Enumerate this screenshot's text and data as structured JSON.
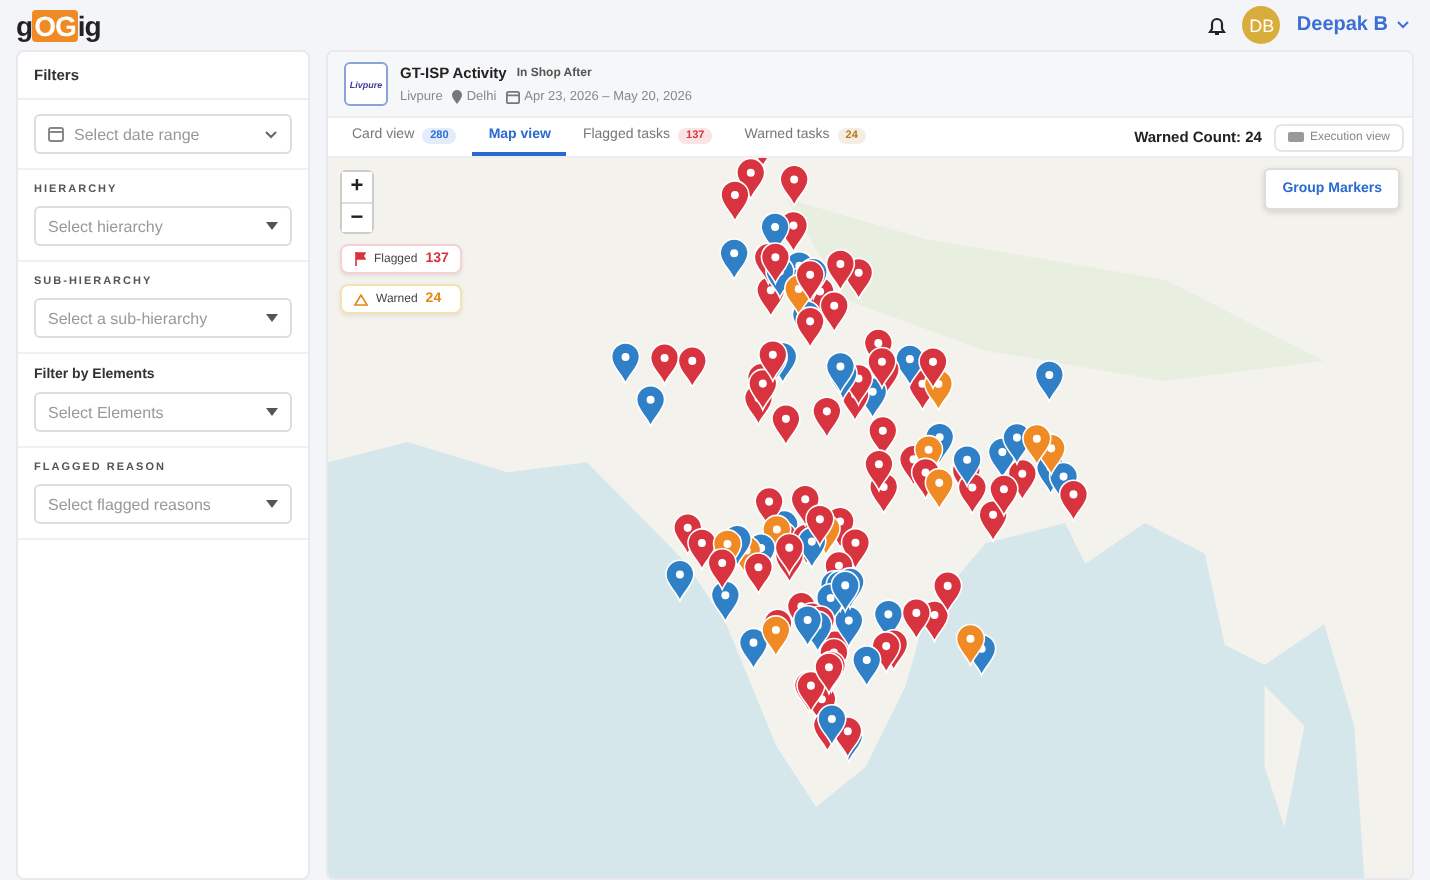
{
  "logo": {
    "before": "g",
    "highlight": "OG",
    "after": "ig"
  },
  "user": {
    "initials": "DB",
    "name": "Deepak B"
  },
  "filters": {
    "title": "Filters",
    "items": [
      {
        "kind": "date",
        "placeholder": "Select date range"
      },
      {
        "kind": "select",
        "label": {
          "text": "HIERARCHY",
          "kind": "caps"
        },
        "placeholder": "Select hierarchy"
      },
      {
        "kind": "select",
        "label": {
          "text": "SUB-HIERARCHY",
          "kind": "caps"
        },
        "placeholder": "Select a sub-hierarchy"
      },
      {
        "kind": "select",
        "label": {
          "text": "Filter by Elements",
          "kind": "plain"
        },
        "placeholder": "Select Elements"
      },
      {
        "kind": "select",
        "label": {
          "text": "FLAGGED REASON",
          "kind": "caps"
        },
        "placeholder": "Select flagged reasons"
      }
    ]
  },
  "activity": {
    "brand_logo": "Livpure",
    "title": "GT-ISP Activity",
    "subtitle": "In Shop After",
    "brand": "Livpure",
    "location": "Delhi",
    "dates": "Apr 23, 2026 – May 20, 2026"
  },
  "tabs": [
    {
      "label": "Card view",
      "count": "280",
      "color": "#2f6fd6",
      "selected": false
    },
    {
      "label": "Map view",
      "selected": true
    },
    {
      "label": "Flagged tasks",
      "count": "137",
      "color": "#d8343f",
      "selected": false
    },
    {
      "label": "Warned tasks",
      "count": "24",
      "color": "#b7791f",
      "selected": false
    }
  ],
  "warned_count": "Warned Count: 24",
  "execution_view": {
    "label": "Execution view",
    "on": false
  },
  "map": {
    "legend": [
      {
        "kind": "flagged",
        "label": "Flagged",
        "count": "137"
      },
      {
        "kind": "warned",
        "label": "Warned",
        "count": "24"
      }
    ],
    "group_button": "Group Markers",
    "zoom_in": "+",
    "zoom_out": "−"
  }
}
